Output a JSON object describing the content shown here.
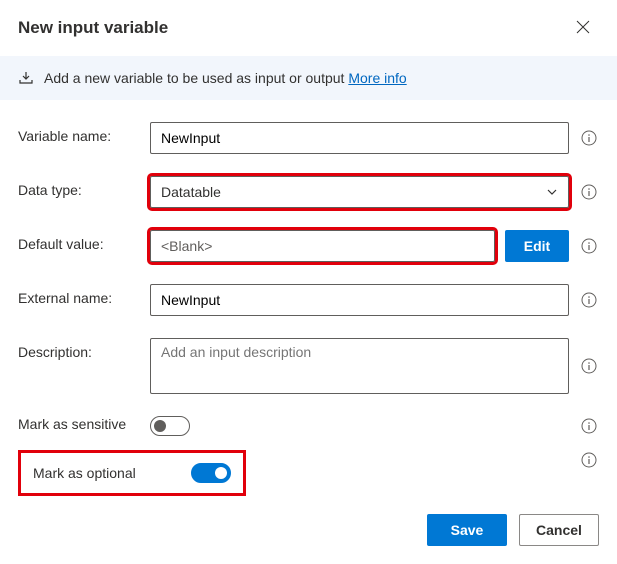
{
  "dialog": {
    "title": "New input variable"
  },
  "banner": {
    "text": "Add a new variable to be used as input or output",
    "link_text": "More info"
  },
  "form": {
    "variable_name": {
      "label": "Variable name:",
      "value": "NewInput"
    },
    "data_type": {
      "label": "Data type:",
      "value": "Datatable"
    },
    "default_value": {
      "label": "Default value:",
      "value": "<Blank>",
      "edit_label": "Edit"
    },
    "external_name": {
      "label": "External name:",
      "value": "NewInput"
    },
    "description": {
      "label": "Description:",
      "placeholder": "Add an input description"
    },
    "mark_sensitive": {
      "label": "Mark as sensitive"
    },
    "mark_optional": {
      "label": "Mark as optional"
    }
  },
  "footer": {
    "save_label": "Save",
    "cancel_label": "Cancel"
  }
}
